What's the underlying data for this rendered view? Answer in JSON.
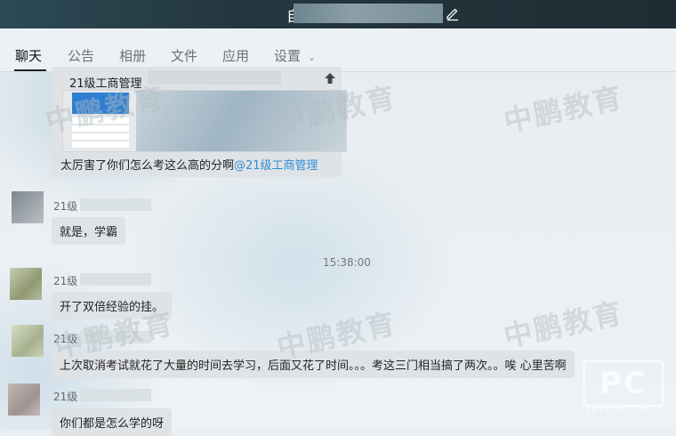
{
  "window": {
    "title": "自考"
  },
  "tabs": [
    {
      "label": "聊天"
    },
    {
      "label": "公告"
    },
    {
      "label": "相册"
    },
    {
      "label": "文件"
    },
    {
      "label": "应用"
    },
    {
      "label": "设置"
    }
  ],
  "watermark": "中鹏教育",
  "logo": {
    "mark": "PC",
    "site": "PHPCMS.CN"
  },
  "messages": [
    {
      "card_title": "21级工商管理",
      "text": "太厉害了你们怎么考这么高的分啊",
      "mention": "@21级工商管理"
    },
    {
      "sender": "21级",
      "text": "就是，学霸"
    },
    {
      "time": "15:38:00"
    },
    {
      "sender": "21级",
      "text": "开了双倍经验的挂。"
    },
    {
      "sender": "21级",
      "text": "上次取消考试就花了大量的时间去学习，后面又花了时间。。。考这三门相当搞了两次。。唉 心里苦啊"
    },
    {
      "sender": "21级",
      "text": "你们都是怎么学的呀"
    }
  ],
  "colors": {
    "accent": "#2e8fd6",
    "titlebar": "#24373f"
  }
}
